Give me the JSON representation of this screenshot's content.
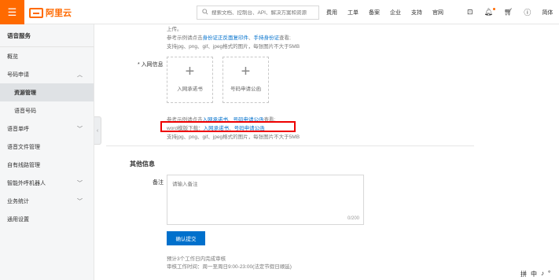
{
  "header": {
    "logo_text": "阿里云",
    "search_placeholder": "搜索文档、控制台、API、解决方案和资源",
    "nav": [
      "费用",
      "工单",
      "备案",
      "企业",
      "支持",
      "官网"
    ],
    "lang": "简体",
    "accent": "#ff6a00"
  },
  "sidebar": {
    "title": "语音服务",
    "items": [
      {
        "label": "概览"
      },
      {
        "label": "号码申请"
      },
      {
        "label": "资源管理"
      },
      {
        "label": "语音号码"
      },
      {
        "label": "语音单呼"
      },
      {
        "label": "语音文件管理"
      },
      {
        "label": "自有线路管理"
      },
      {
        "label": "智能外呼机器人"
      },
      {
        "label": "业务统计"
      },
      {
        "label": "通用设置"
      }
    ]
  },
  "form": {
    "top_lines": [
      "上传。",
      "参考示例请点击",
      "身份证正反面复印件",
      "、",
      "手持身份证",
      "查看;",
      "支持jpg、png、gif、jpeg格式的图片，每张图片不大于5MB"
    ],
    "network_label": "* 入网信息",
    "upload1_caption": "入网承诺书",
    "upload2_caption": "号码申请公函",
    "ref_prefix": "参考示例请点击",
    "ref_link1": "入网承诺书",
    "ref_sep": "、",
    "ref_link2": "号码申请公函",
    "ref_suffix": "查看;",
    "word_prefix": "word模版下载：",
    "word_link1": "入网承诺书",
    "word_sep": "、",
    "word_link2": "号码申请公函",
    "format_note": "支持jpg、png、gif、jpeg格式的图片，每张图片不大于5MB",
    "section_title": "其他信息",
    "remark_label": "备注",
    "remark_placeholder": "请输入备注",
    "remark_counter": "0/200",
    "submit_label": "确认提交",
    "note1": "预计3个工作日内完成审核",
    "note2": "审核工作时间：周一至周日9:00-23:00(法定节假日顺延)"
  },
  "ime": [
    "拼",
    "中",
    "♪",
    "°"
  ]
}
